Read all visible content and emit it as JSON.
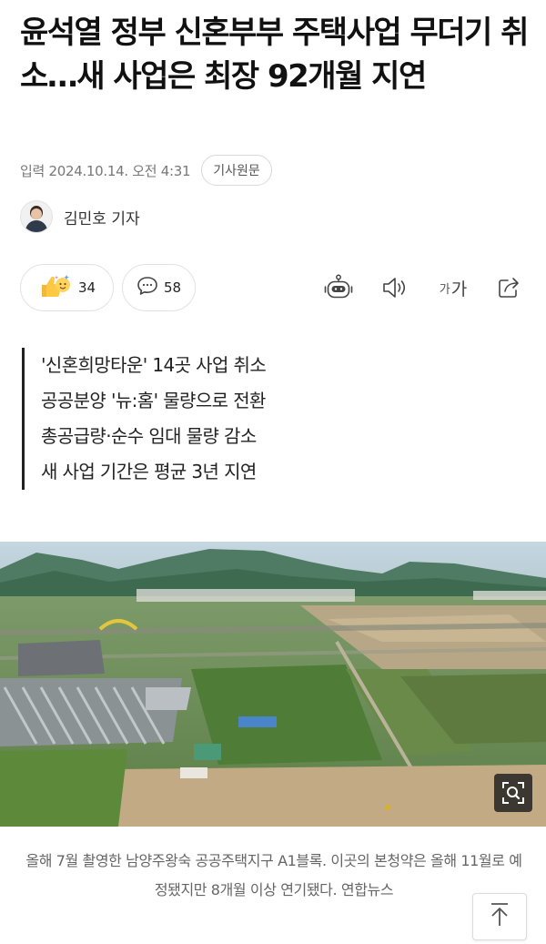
{
  "article": {
    "headline": "윤석열 정부 신혼부부 주택사업 무더기 취소…새 사업은 최장 92개월 지연",
    "meta": {
      "date": "입력 2024.10.14. 오전 4:31",
      "original_button": "기사원문"
    },
    "author": {
      "name": "김민호 기자"
    },
    "actions": {
      "reaction_count": "34",
      "comment_count": "58",
      "font_small": "가",
      "font_big": "가"
    },
    "summary": [
      "'신혼희망타운' 14곳 사업 취소",
      "공공분양 '뉴:홈' 물량으로 전환",
      "총공급량·순수 임대 물량 감소",
      "새 사업 기간은 평균 3년 지연"
    ],
    "photo": {
      "caption": "올해 7월 촬영한 남양주왕숙 공공주택지구 A1블록. 이곳의 본청약은 올해 11월로 예정됐지만 8개월 이상 연기됐다. 연합뉴스"
    }
  },
  "icons": {
    "reaction": "thumbs-up-sparkle-emoji",
    "comment": "speech-bubble-icon",
    "summary_bot": "robot-icon",
    "tts": "speaker-icon",
    "share": "share-icon",
    "zoom": "zoom-icon",
    "scroll_top": "arrow-up-icon"
  }
}
